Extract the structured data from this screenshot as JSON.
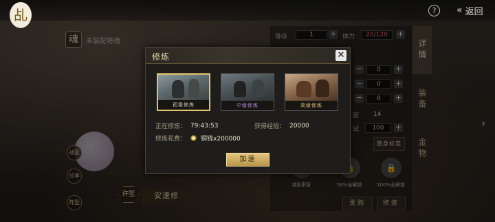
{
  "topbar": {
    "logo_char": "乩",
    "help_label": "?",
    "back_label": "返回"
  },
  "soul": {
    "char": "魂",
    "text": "未装配将魂"
  },
  "left_skills": [
    {
      "label": "战意"
    },
    {
      "label": "分享"
    },
    {
      "label": "阵型"
    }
  ],
  "speed": {
    "hex_label": "许笙",
    "label": "安速修"
  },
  "right_tabs": [
    "详情",
    "装备",
    "金物"
  ],
  "right_panel": {
    "level_label": "等级",
    "level_value": "1",
    "stamina_label": "体力",
    "stamina_value": "20/120",
    "counters": [
      "0",
      "0",
      "0"
    ],
    "stat_label_a": "度",
    "stat_value_a": "14",
    "stat_label_b": "试",
    "stat_value_b": "100",
    "hide_label": "隐身标准",
    "locks": [
      {
        "label": "减免率智"
      },
      {
        "label": "50%全解锁"
      },
      {
        "label": "100%全解锁"
      }
    ],
    "buy_label": "贯购",
    "train_label": "修炼"
  },
  "modal": {
    "title": "修炼",
    "close_label": "✕",
    "options": [
      {
        "caption": "初级修炼",
        "caption_color": "#d8d0b8",
        "selected": true
      },
      {
        "caption": "中级修炼",
        "caption_color": "#b78be0",
        "selected": false
      },
      {
        "caption": "高级修炼",
        "caption_color": "#e8c07a",
        "selected": false
      }
    ],
    "training_label": "正在修炼：",
    "training_time": "79:43:53",
    "exp_label": "获得经验：",
    "exp_value": "20000",
    "cost_label": "修炼花费：",
    "cost_value": "铜钱x200000",
    "accelerate_label": "加速"
  }
}
